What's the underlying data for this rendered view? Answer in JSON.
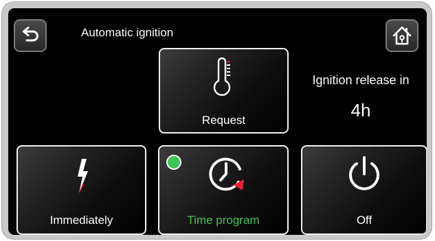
{
  "header": {
    "title": "Automatic ignition",
    "back_icon": "undo-arrow-icon",
    "home_icon": "home-icon"
  },
  "tiles": {
    "request": {
      "label": "Request",
      "icon": "thermometer-icon"
    },
    "immediately": {
      "label": "Immediately",
      "icon": "lightning-bolt-icon"
    },
    "time_program": {
      "label": "Time program",
      "icon": "clock-timer-icon",
      "active": true
    },
    "off": {
      "label": "Off",
      "icon": "power-icon"
    }
  },
  "release": {
    "text": "Ignition release in",
    "value": "4h"
  },
  "colors": {
    "active_green": "#3fc45a",
    "accent_red": "#e8213a",
    "tile_border": "#f2f2f2"
  }
}
